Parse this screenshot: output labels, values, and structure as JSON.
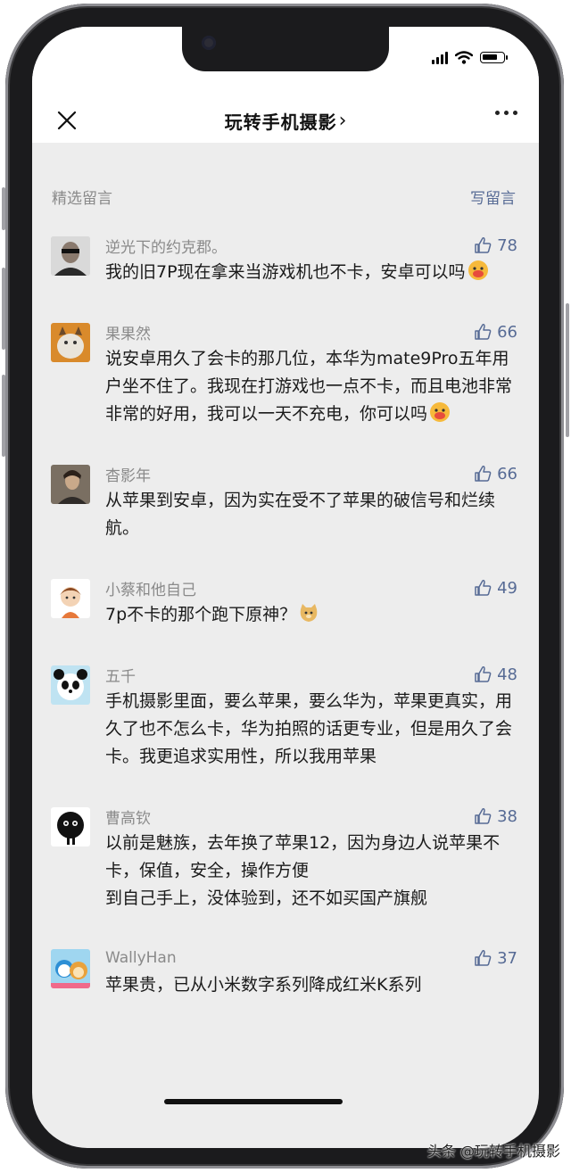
{
  "nav": {
    "title": "玩转手机摄影",
    "chevron": "›"
  },
  "section": {
    "title": "精选留言",
    "write_link": "写留言"
  },
  "comments": [
    {
      "name": "逆光下的约克郡。",
      "likes": "78",
      "text": "我的旧7P现在拿来当游戏机也不卡，安卓可以吗",
      "emoji": "hot-face-emoji"
    },
    {
      "name": "果果然",
      "likes": "66",
      "text": "说安卓用久了会卡的那几位，本华为mate9Pro五年用户坐不住了。我现在打游戏也一点不卡，而且电池非常非常的好用，我可以一天不充电，你可以吗",
      "emoji": "hot-face-emoji"
    },
    {
      "name": "杳影年",
      "likes": "66",
      "text": "从苹果到安卓，因为实在受不了苹果的破信号和烂续航。"
    },
    {
      "name": "小蔡和他自己",
      "likes": "49",
      "text": "7p不卡的那个跑下原神？",
      "emoji": "doge-emoji"
    },
    {
      "name": "五千",
      "likes": "48",
      "text": "手机摄影里面，要么苹果，要么华为，苹果更真实，用久了也不怎么卡，华为拍照的话更专业，但是用久了会卡。我更追求实用性，所以我用苹果"
    },
    {
      "name": "曹高钦",
      "likes": "38",
      "text": "以前是魅族，去年换了苹果12，因为身边人说苹果不卡，保值，安全，操作方便\n到自己手上，没体验到，还不如买国产旗舰"
    },
    {
      "name": "WallyHan",
      "likes": "37",
      "text": "苹果贵，已从小米数字系列降成红米K系列"
    }
  ],
  "watermark": "头条 @玩转手机摄影",
  "colors": {
    "link": "#576b95",
    "background": "#ededed",
    "name": "#8a8a8a"
  }
}
